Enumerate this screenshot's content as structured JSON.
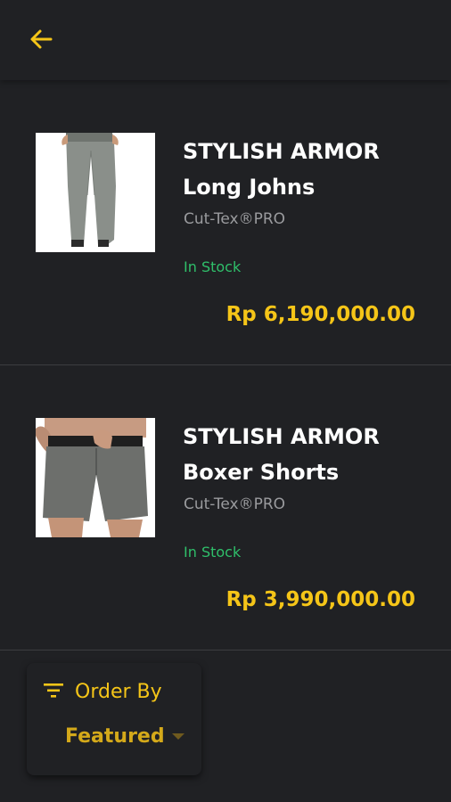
{
  "header": {
    "back_icon": "arrow-left-icon"
  },
  "products": [
    {
      "title_line1": "STYLISH ARMOR",
      "title_line2": "Long Johns",
      "brand": "Cut-Tex®PRO",
      "stock": "In Stock",
      "price": "Rp 6,190,000.00",
      "image": "pants-photo"
    },
    {
      "title_line1": "STYLISH ARMOR",
      "title_line2": "Boxer Shorts",
      "brand": "Cut-Tex®PRO",
      "stock": "In Stock",
      "price": "Rp 3,990,000.00",
      "image": "shorts-photo"
    }
  ],
  "order": {
    "label": "Order By",
    "value": "Featured",
    "icon": "filter-icon"
  },
  "colors": {
    "background": "#202124",
    "accent": "#f5c518",
    "stock": "#2fbf6a",
    "muted": "#9a9b9e"
  }
}
